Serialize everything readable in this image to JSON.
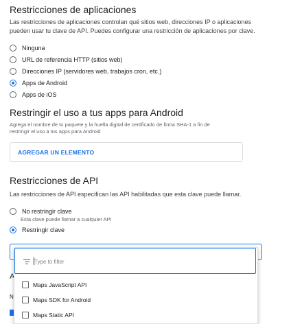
{
  "app_restrictions": {
    "title": "Restricciones de aplicaciones",
    "description_line1": "Las restricciones de aplicaciones controlan qué sitios web, direcciones IP o aplicaciones",
    "description_line2": "pueden usar tu clave de API. Puedes configurar una restricción de aplicaciones por clave.",
    "options": [
      {
        "label": "Ninguna",
        "checked": false
      },
      {
        "label": "URL de referencia HTTP (sitios web)",
        "checked": false
      },
      {
        "label": "Direcciones IP (servidores web, trabajos cron, etc.)",
        "checked": false
      },
      {
        "label": "Apps de Android",
        "checked": true
      },
      {
        "label": "Apps de iOS",
        "checked": false
      }
    ]
  },
  "android": {
    "title": "Restringir el uso a tus apps para Android",
    "hint_line1": "Agrega el nombre de tu paquete y la huella digital de certificado de firma SHA-1 a fin de",
    "hint_line2": "restringir el uso a tus apps para Android",
    "add_button": "AGREGAR UN ELEMENTO"
  },
  "api_restrictions": {
    "title": "Restricciones de API",
    "description": "Las restricciones de API especifican las API habilitadas que esta clave puede llamar.",
    "options": [
      {
        "label": "No restringir clave",
        "sublabel": "Esta clave puede llamar a cualquier API",
        "checked": false
      },
      {
        "label": "Restringir clave",
        "checked": true
      }
    ],
    "underlay_text_1": "A",
    "underlay_text_2": "N"
  },
  "dropdown": {
    "filter_placeholder": "Type to filter",
    "filter_value": "",
    "items": [
      {
        "label": "Maps JavaScript API",
        "checked": false
      },
      {
        "label": "Maps SDK for Android",
        "checked": false
      },
      {
        "label": "Maps Static API",
        "checked": false
      }
    ]
  },
  "colors": {
    "accent": "#1a73e8",
    "text": "#202124",
    "muted": "#5f6368"
  }
}
